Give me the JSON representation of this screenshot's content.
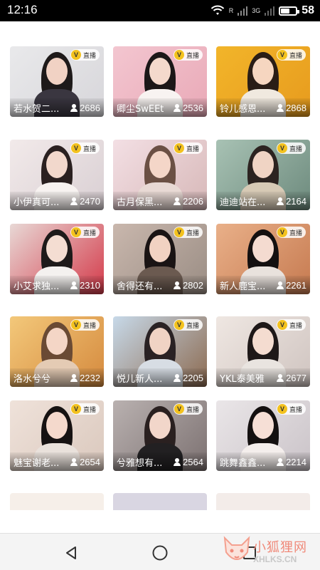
{
  "status_bar": {
    "time": "12:16",
    "signal_r": "R",
    "network": "3G",
    "battery_level": "58",
    "battery_fraction": 0.58
  },
  "badge": {
    "v": "V",
    "live": "直播"
  },
  "streams": [
    {
      "name": "若水贺二...",
      "viewers": "2686"
    },
    {
      "name": "卿尘SwEEt",
      "viewers": "2536"
    },
    {
      "name": "铃儿感恩...",
      "viewers": "2868"
    },
    {
      "name": "小伊真可...",
      "viewers": "2470"
    },
    {
      "name": "古月保黑...",
      "viewers": "2206"
    },
    {
      "name": "迪迪站在...",
      "viewers": "2164"
    },
    {
      "name": "小艾求独...",
      "viewers": "2310"
    },
    {
      "name": "舍得还有...",
      "viewers": "2802"
    },
    {
      "name": "新人鹿宝...",
      "viewers": "2261"
    },
    {
      "name": "洛水兮兮",
      "viewers": "2232"
    },
    {
      "name": "悦儿新人...",
      "viewers": "2205"
    },
    {
      "name": "YKL泰美雅",
      "viewers": "2677"
    },
    {
      "name": "魅宝谢老...",
      "viewers": "2654"
    },
    {
      "name": "兮雅想有...",
      "viewers": "2564"
    },
    {
      "name": "跳舞鑫鑫...",
      "viewers": "2214"
    }
  ],
  "watermark": {
    "name": "小狐狸网",
    "url": "XHLKS.CN"
  },
  "icons": {
    "wifi": "wifi-icon",
    "signal": "signal-icon",
    "battery": "battery-icon",
    "viewers": "user-icon",
    "back": "back-triangle-icon",
    "home": "home-circle-icon",
    "recents": "recents-square-icon"
  }
}
